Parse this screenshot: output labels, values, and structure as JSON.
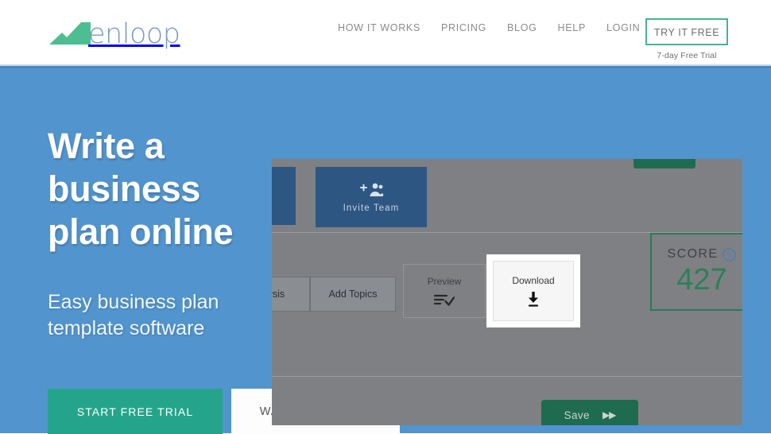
{
  "header": {
    "logo": {
      "icon": "mountain-chart-icon",
      "text": "enloop",
      "mark_color": "#4dbd93",
      "text_color": "#7b9ac4"
    },
    "nav": [
      {
        "label": "HOW IT WORKS",
        "name": "nav-how-it-works"
      },
      {
        "label": "PRICING",
        "name": "nav-pricing"
      },
      {
        "label": "BLOG",
        "name": "nav-blog"
      },
      {
        "label": "HELP",
        "name": "nav-help"
      },
      {
        "label": "LOGIN",
        "name": "nav-login"
      }
    ],
    "try_free_label": "TRY IT FREE",
    "trial_note": "7-day Free Trial",
    "try_free_border_color": "#45b48e"
  },
  "hero": {
    "background_color": "#5294cd",
    "headline": "Write a business plan online",
    "subheadline": "Easy business plan template software",
    "cta_primary": {
      "label": "START FREE TRIAL",
      "color": "#24a58b"
    },
    "cta_secondary": {
      "label": "WATCH VIDEO",
      "icon": "play-circle-icon",
      "color": "#fdfdfd"
    }
  },
  "screenshot": {
    "invite_team": {
      "label": "Invite Team",
      "icon": "add-people-icon"
    },
    "tabs": [
      {
        "label": "lysis",
        "name": "tab-analysis-truncated"
      },
      {
        "label": "Add Topics",
        "name": "tab-add-topics"
      }
    ],
    "preview": {
      "label": "Preview",
      "icon": "list-check-icon"
    },
    "download": {
      "label": "Download",
      "icon": "download-arrow-icon"
    },
    "score": {
      "label": "SCORE",
      "value": "427",
      "icon": "help-circle-icon",
      "border_color": "#2a7a56",
      "value_color": "#2c8058"
    },
    "save": {
      "label": "Save",
      "icon": "double-chevron-right-icon",
      "color": "#1f6b4f"
    }
  }
}
